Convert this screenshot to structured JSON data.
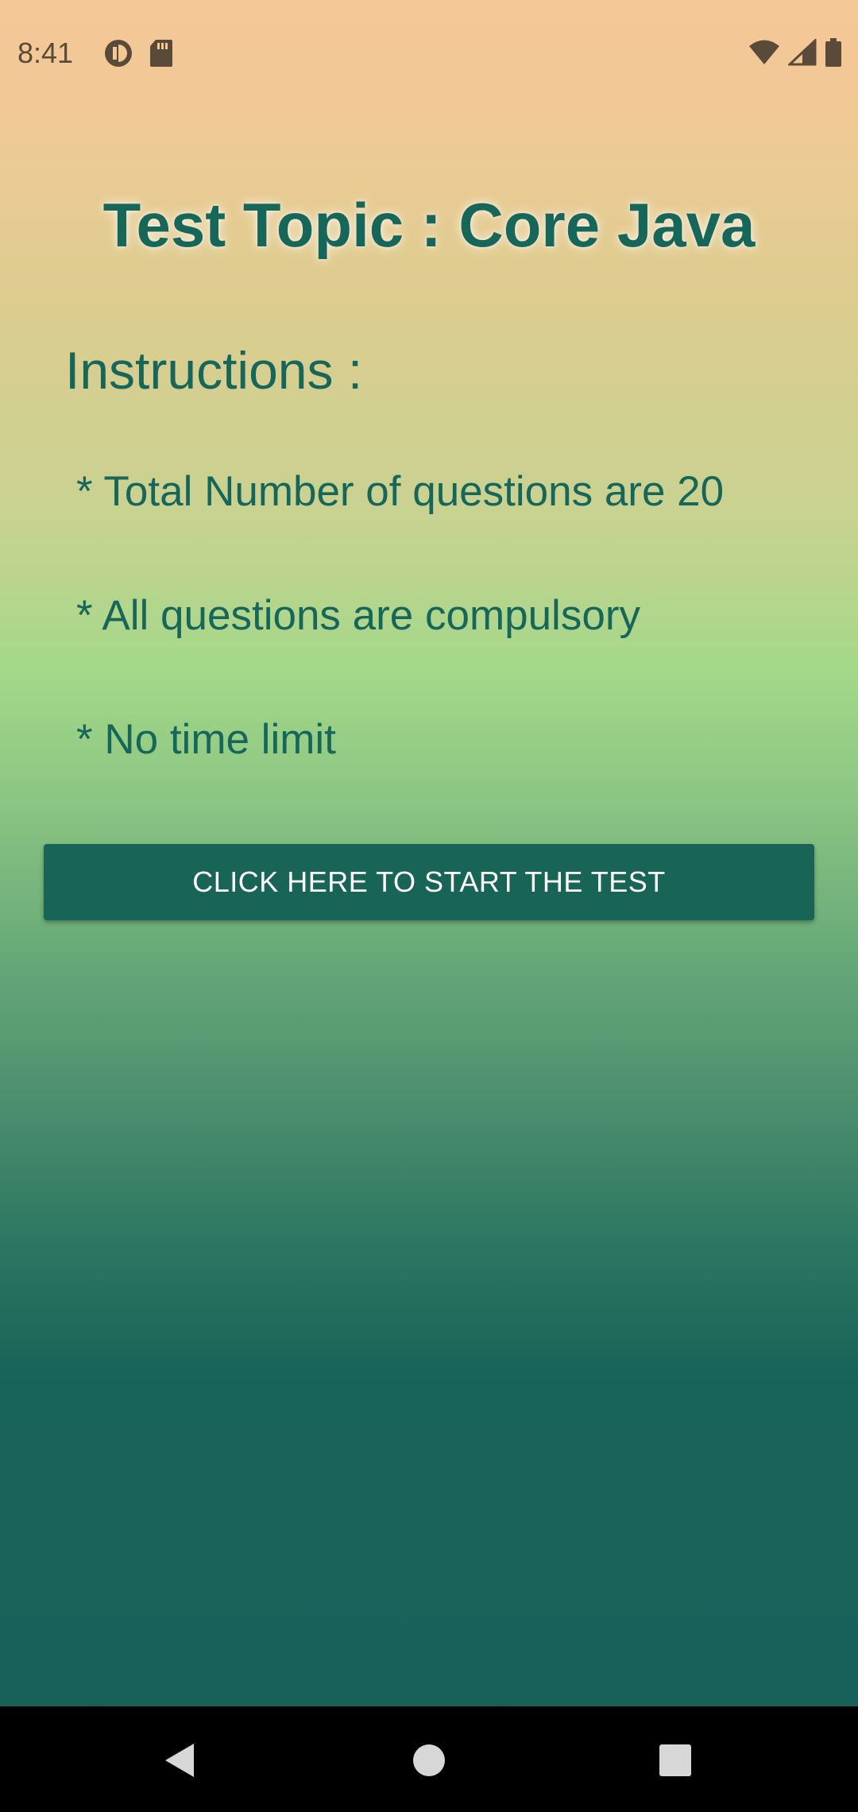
{
  "status_bar": {
    "time": "8:41",
    "left_icons": [
      "data-saver-icon",
      "sd-card-icon"
    ],
    "right_icons": [
      "wifi-icon",
      "signal-icon",
      "battery-icon"
    ],
    "icon_color": "#5a4a3a"
  },
  "main": {
    "title": "Test Topic : Core Java",
    "instructions_heading": "Instructions :",
    "instructions": [
      "* Total Number of questions are 20",
      "* All questions are compulsory",
      "* No time limit"
    ],
    "start_button_label": "CLICK HERE TO START THE TEST"
  },
  "nav_bar": {
    "buttons": [
      "back-icon",
      "home-icon",
      "recents-icon"
    ]
  },
  "colors": {
    "accent": "#17665a",
    "button_bg": "#186457",
    "gradient_top": "#f4c897",
    "gradient_mid": "#a3d889",
    "gradient_bottom": "#17605a"
  }
}
